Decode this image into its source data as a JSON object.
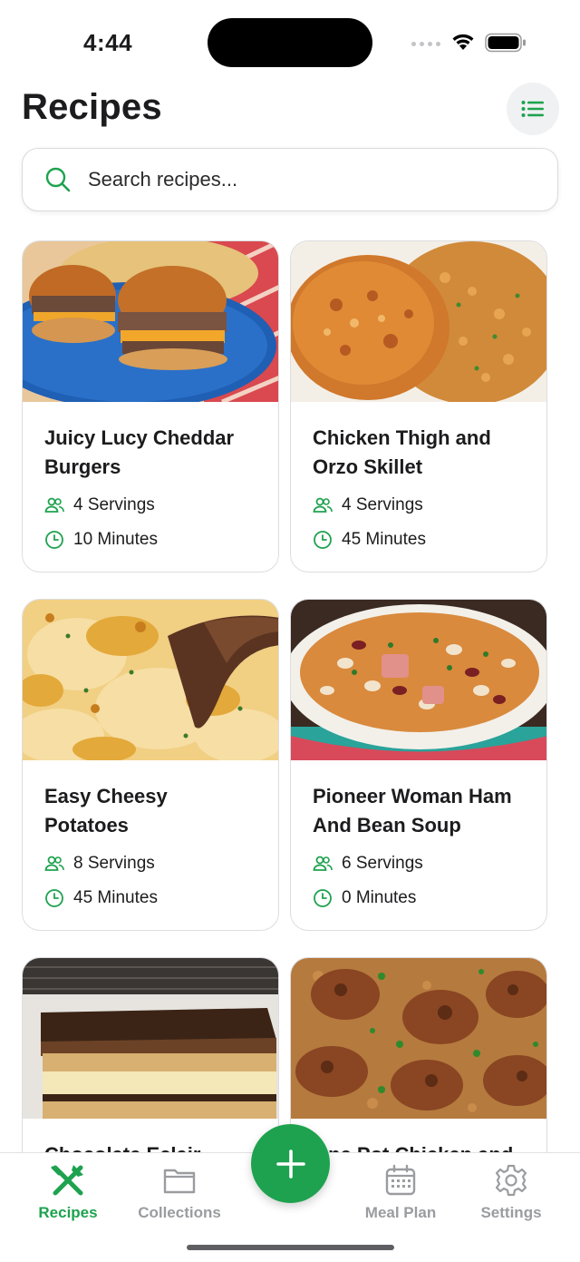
{
  "status_bar": {
    "time": "4:44"
  },
  "header": {
    "title": "Recipes",
    "view_toggle_icon": "list-icon"
  },
  "search": {
    "placeholder": "Search recipes...",
    "value": ""
  },
  "recipes": [
    {
      "title": "Juicy Lucy Cheddar Burgers",
      "servings": "4 Servings",
      "time": "10 Minutes"
    },
    {
      "title": "Chicken Thigh and Orzo Skillet",
      "servings": "4 Servings",
      "time": "45 Minutes"
    },
    {
      "title": "Easy Cheesy Potatoes",
      "servings": "8 Servings",
      "time": "45 Minutes"
    },
    {
      "title": "Pioneer Woman Ham And Bean Soup",
      "servings": "6 Servings",
      "time": "0 Minutes"
    },
    {
      "title": "Chocolate Eclair",
      "servings": "",
      "time": ""
    },
    {
      "title": "One Pot Chicken and",
      "servings": "",
      "time": ""
    }
  ],
  "tab_bar": {
    "tabs": [
      {
        "label": "Recipes",
        "icon": "utensils-icon",
        "active": true
      },
      {
        "label": "Collections",
        "icon": "folder-icon",
        "active": false
      },
      {
        "label": "Meal Plan",
        "icon": "calendar-icon",
        "active": false
      },
      {
        "label": "Settings",
        "icon": "gear-icon",
        "active": false
      }
    ],
    "fab_icon": "plus-icon"
  },
  "colors": {
    "accent": "#1ea24f",
    "inactive": "#9a9ca0",
    "text": "#1c1c1e"
  }
}
